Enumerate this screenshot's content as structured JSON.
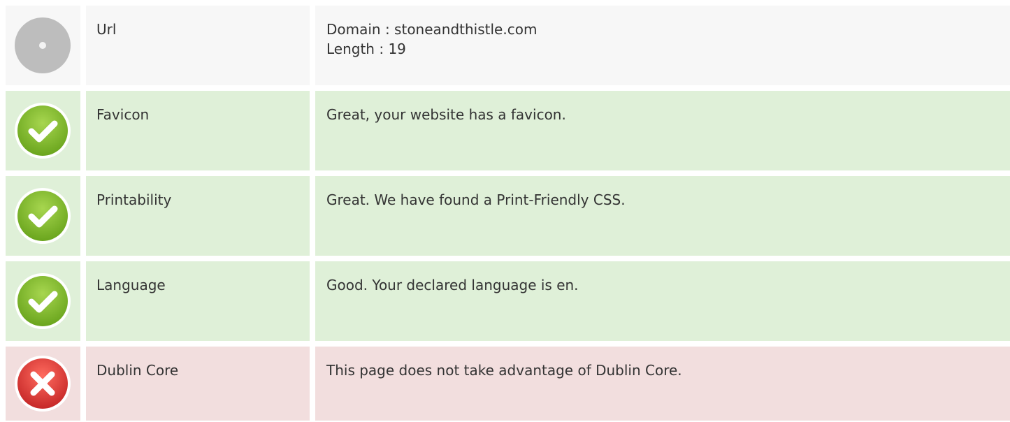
{
  "rows": [
    {
      "status": "neutral",
      "icon": "neutral-circle-icon",
      "name": "Url",
      "value_lines": [
        "Domain : stoneandthistle.com",
        "Length : 19"
      ]
    },
    {
      "status": "good",
      "icon": "check-circle-icon",
      "name": "Favicon",
      "value_lines": [
        "Great, your website has a favicon."
      ]
    },
    {
      "status": "good",
      "icon": "check-circle-icon",
      "name": "Printability",
      "value_lines": [
        "Great. We have found a Print-Friendly CSS."
      ]
    },
    {
      "status": "good",
      "icon": "check-circle-icon",
      "name": "Language",
      "value_lines": [
        "Good. Your declared language is en."
      ]
    },
    {
      "status": "bad",
      "icon": "error-circle-icon",
      "name": "Dublin Core",
      "value_lines": [
        "This page does not take advantage of Dublin Core."
      ]
    }
  ],
  "colors": {
    "neutral_bg": "#f7f7f7",
    "good_bg": "#dff0d8",
    "bad_bg": "#f2dede",
    "good_icon": "#8cc63f",
    "bad_icon": "#e53935",
    "neutral_icon": "#bdbdbd"
  }
}
